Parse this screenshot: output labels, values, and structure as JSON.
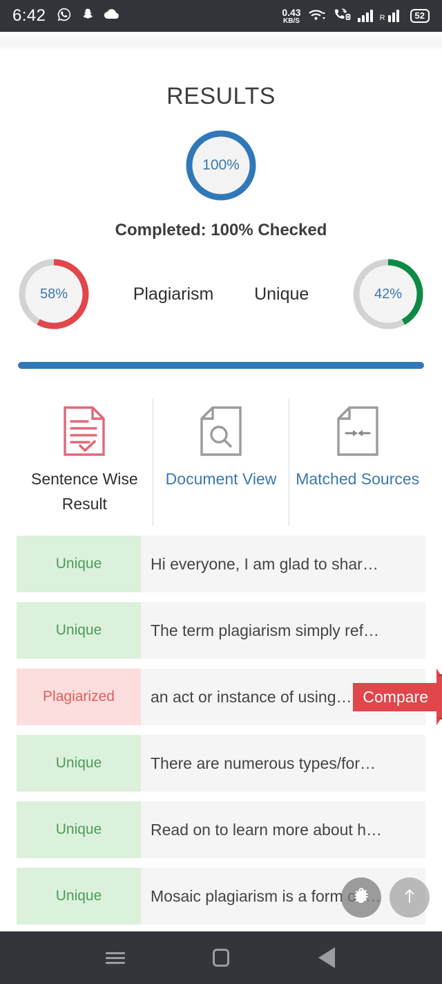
{
  "statusbar": {
    "time": "6:42",
    "left_icons": [
      "whatsapp-icon",
      "snapchat-icon",
      "cloud-icon"
    ],
    "net_rate": "0.43",
    "net_unit": "KB/S",
    "right_icons": [
      "wifi-icon",
      "volte-call-icon",
      "signal-icon",
      "signal-roaming-icon"
    ],
    "roaming_label": "R",
    "battery": "52"
  },
  "page": {
    "title": "RESULTS",
    "completed_text": "Completed: 100% Checked"
  },
  "completion_gauge": {
    "value": "100%",
    "percent": 100,
    "color": "#3178b8"
  },
  "gauges": [
    {
      "name": "plagiarism-gauge",
      "value": "42%",
      "percent": 42,
      "label": "Unique",
      "color": "#e0464a"
    }
  ],
  "plagiarism": {
    "value": "58%",
    "percent": 58,
    "label": "Plagiarism",
    "color": "#e0464a"
  },
  "unique": {
    "value": "42%",
    "percent": 42,
    "label": "Unique",
    "color": "#0d8a44"
  },
  "progress": {
    "percent": 100,
    "color": "#3178b8"
  },
  "tabs": [
    {
      "label": "Sentence Wise Result",
      "icon": "document-check-icon",
      "active": true,
      "color": "#e0687a"
    },
    {
      "label": "Document View",
      "icon": "document-search-icon",
      "active": false,
      "color": "#3a78ad"
    },
    {
      "label": "Matched Sources",
      "icon": "document-arrows-icon",
      "active": false,
      "color": "#3a78ad"
    }
  ],
  "rows": [
    {
      "tag": "Unique",
      "status": "unique",
      "text": "Hi everyone, I am glad to shar…",
      "compare": null
    },
    {
      "tag": "Unique",
      "status": "unique",
      "text": "The term plagiarism simply ref…",
      "compare": null
    },
    {
      "tag": "Plagiarized",
      "status": "plag",
      "text": "an act or instance of using…",
      "compare": "Compare"
    },
    {
      "tag": "Unique",
      "status": "unique",
      "text": "There are numerous types/for…",
      "compare": null
    },
    {
      "tag": "Unique",
      "status": "unique",
      "text": "Read on to learn more about h…",
      "compare": null
    },
    {
      "tag": "Unique",
      "status": "unique",
      "text": "Mosaic plagiarism is a form of …",
      "compare": null
    }
  ],
  "fabs": [
    {
      "name": "bug-report-button",
      "icon": "bug-icon"
    },
    {
      "name": "scroll-to-top-button",
      "icon": "arrow-up-icon"
    }
  ],
  "navbar": [
    {
      "name": "recents-button",
      "icon": "hamburger-icon"
    },
    {
      "name": "home-button",
      "icon": "square-icon"
    },
    {
      "name": "back-button",
      "icon": "triangle-back-icon"
    }
  ]
}
